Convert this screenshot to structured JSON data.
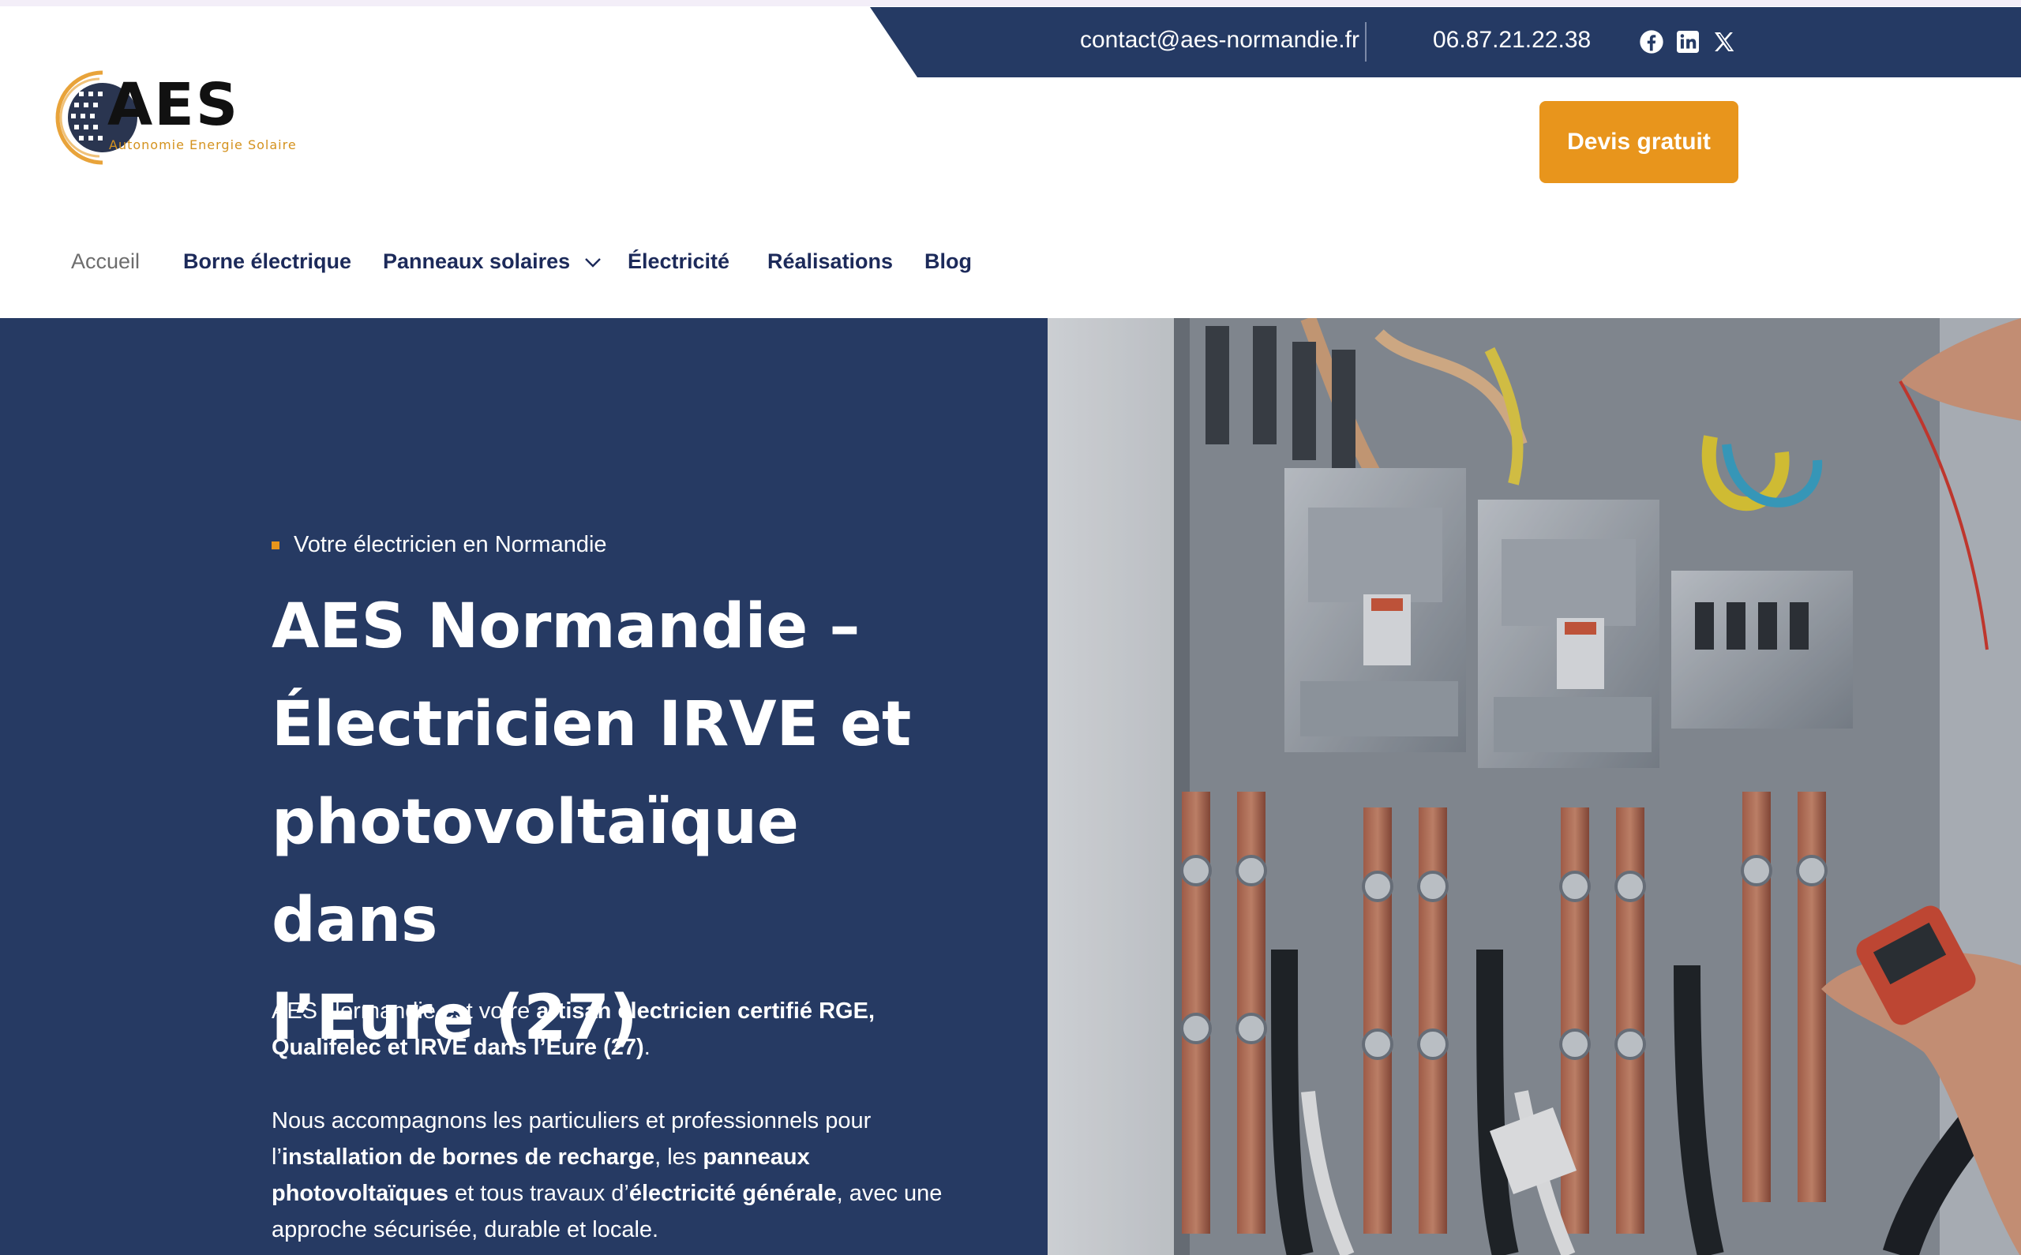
{
  "header": {
    "email": "contact@aes-normandie.fr",
    "phone": "06.87.21.22.38",
    "social": [
      "facebook-icon",
      "linkedin-icon",
      "x-icon"
    ],
    "cta": "Devis gratuit"
  },
  "logo": {
    "text": "AES",
    "tagline": "Autonomie Energie Solaire"
  },
  "nav": {
    "items": [
      {
        "label": "Accueil",
        "active": true
      },
      {
        "label": "Borne électrique"
      },
      {
        "label": "Panneaux solaires",
        "has_dropdown": true
      },
      {
        "label": "Électricité"
      },
      {
        "label": "Réalisations"
      },
      {
        "label": "Blog"
      }
    ]
  },
  "hero": {
    "eyebrow": "Votre électricien en Normandie",
    "title_lines": [
      "AES Normandie –",
      "Électricien IRVE et",
      "photovoltaïque dans",
      "l’Eure (27)"
    ],
    "p1": {
      "before": "AES Normandie est votre ",
      "bold": "artisan électricien certifié RGE, Qualifelec et IRVE dans l’Eure (27)",
      "after": "."
    },
    "p2": {
      "t1": "Nous accompagnons les particuliers et professionnels pour l’",
      "b1": "installation de bornes de recharge",
      "t2": ", les ",
      "b2": "panneaux photovoltaïques",
      "t3": " et tous travaux d’",
      "b3": "électricité générale",
      "t4": ", avec une approche sécurisée, durable et locale."
    }
  },
  "colors": {
    "navy": "#263a63",
    "orange": "#e8951c",
    "nav_text": "#1c2a5a"
  }
}
